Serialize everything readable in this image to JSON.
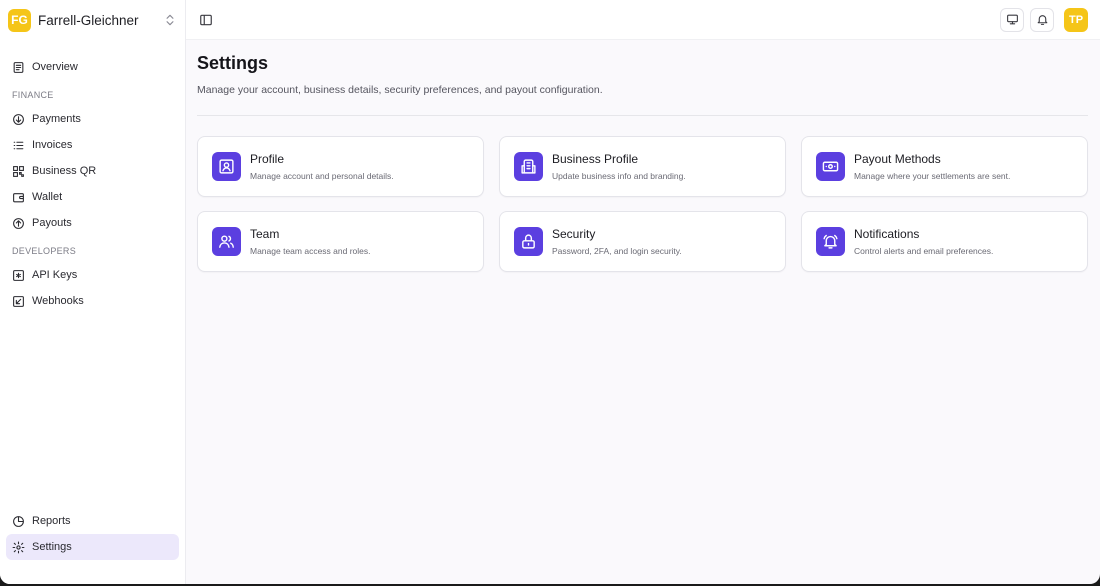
{
  "org": {
    "initials": "FG",
    "name": "Farrell-Gleichner",
    "badge_color": "#f5c518"
  },
  "sidebar": {
    "items": [
      {
        "label": "Overview",
        "icon": "overview-icon"
      }
    ],
    "finance_heading": "FINANCE",
    "finance_items": [
      {
        "label": "Payments",
        "icon": "payments-icon"
      },
      {
        "label": "Invoices",
        "icon": "invoices-icon"
      },
      {
        "label": "Business QR",
        "icon": "qr-icon"
      },
      {
        "label": "Wallet",
        "icon": "wallet-icon"
      },
      {
        "label": "Payouts",
        "icon": "payouts-icon"
      }
    ],
    "developers_heading": "DEVELOPERS",
    "developer_items": [
      {
        "label": "API Keys",
        "icon": "api-keys-icon"
      },
      {
        "label": "Webhooks",
        "icon": "webhooks-icon"
      }
    ],
    "bottom_items": [
      {
        "label": "Reports",
        "icon": "reports-icon"
      },
      {
        "label": "Settings",
        "icon": "settings-icon",
        "active": true
      }
    ]
  },
  "topbar": {
    "user_initials": "TP"
  },
  "page": {
    "title": "Settings",
    "subtitle": "Manage your account, business details, security preferences, and payout configuration."
  },
  "cards": [
    {
      "title": "Profile",
      "desc": "Manage account and personal details.",
      "icon": "profile-icon"
    },
    {
      "title": "Business Profile",
      "desc": "Update business info and branding.",
      "icon": "business-profile-icon"
    },
    {
      "title": "Payout Methods",
      "desc": "Manage where your settlements are sent.",
      "icon": "payout-methods-icon"
    },
    {
      "title": "Team",
      "desc": "Manage team access and roles.",
      "icon": "team-icon"
    },
    {
      "title": "Security",
      "desc": "Password, 2FA, and login security.",
      "icon": "lock-icon"
    },
    {
      "title": "Notifications",
      "desc": "Control alerts and email preferences.",
      "icon": "notifications-icon"
    }
  ],
  "colors": {
    "accent": "#5b3fe0",
    "active_nav_bg": "#ece8fb",
    "avatar": "#f5c518"
  }
}
